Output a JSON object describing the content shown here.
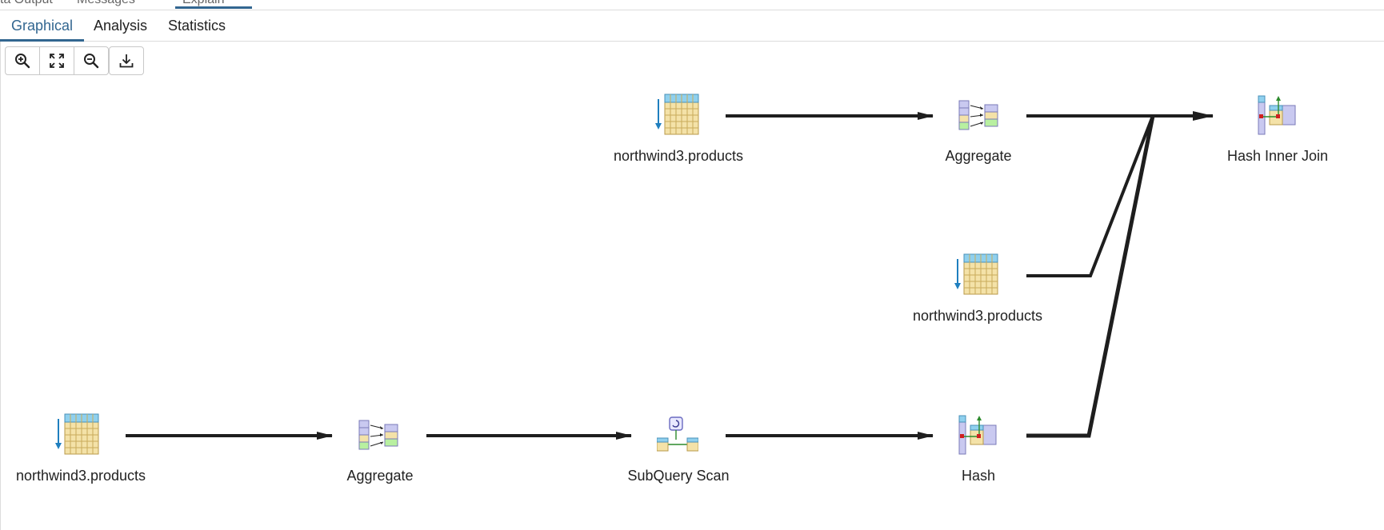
{
  "top_tabs": {
    "partial_texts": [
      "ta Output",
      "Messages",
      "Explain"
    ]
  },
  "tabs": [
    {
      "label": "Graphical",
      "active": true
    },
    {
      "label": "Analysis",
      "active": false
    },
    {
      "label": "Statistics",
      "active": false
    }
  ],
  "toolbar": {
    "buttons": [
      {
        "name": "zoom-in-icon"
      },
      {
        "name": "zoom-to-fit-icon"
      },
      {
        "name": "zoom-out-icon"
      },
      {
        "name": "download-icon"
      }
    ]
  },
  "plan": {
    "nodes": [
      {
        "id": "scan_top",
        "type": "seq-scan-icon",
        "label": "northwind3.products"
      },
      {
        "id": "agg_top",
        "type": "aggregate-icon",
        "label": "Aggregate"
      },
      {
        "id": "join",
        "type": "hash-join-icon",
        "label": "Hash Inner Join"
      },
      {
        "id": "scan_mid",
        "type": "seq-scan-icon",
        "label": "northwind3.products"
      },
      {
        "id": "scan_bottom",
        "type": "seq-scan-icon",
        "label": "northwind3.products"
      },
      {
        "id": "agg_bottom",
        "type": "aggregate-icon",
        "label": "Aggregate"
      },
      {
        "id": "subquery",
        "type": "subquery-scan-icon",
        "label": "SubQuery Scan"
      },
      {
        "id": "hash",
        "type": "hash-icon",
        "label": "Hash"
      }
    ]
  },
  "colors": {
    "accent": "#326690",
    "table_fill": "#f4e2a8",
    "table_header": "#8fd0ee",
    "table_border": "#b89a4a"
  }
}
